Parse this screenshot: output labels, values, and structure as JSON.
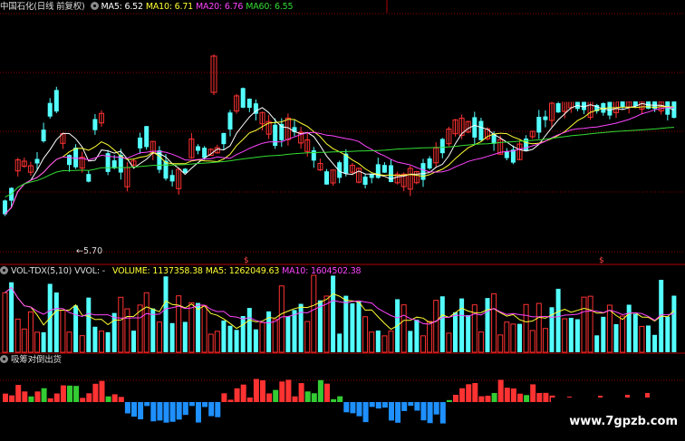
{
  "main": {
    "title": "中国石化(日线 前复权)",
    "ma": [
      {
        "label": "MA5: 6.52",
        "color": "#ffffff"
      },
      {
        "label": "MA10: 6.71",
        "color": "#ffff33"
      },
      {
        "label": "MA20: 6.76",
        "color": "#ff44ff"
      },
      {
        "label": "MA60: 6.55",
        "color": "#33dd33"
      }
    ],
    "low_label": "←5.70",
    "marker": "$"
  },
  "volume": {
    "title": "VOL-TDX(5,10)",
    "vvol": "VVOL: -",
    "volume": "VOLUME: 1137358.38",
    "ma5": "MA5: 1262049.63",
    "ma10": "MA10: 1604502.38",
    "colors": {
      "volume": "#ffff33",
      "ma5": "#ffff33",
      "ma10": "#ff44ff"
    }
  },
  "indicator": {
    "title": "吸筹对倒出货"
  },
  "watermark": "www.7gpzb.com",
  "colors": {
    "up": "#ff3232",
    "down": "#54ffff",
    "neg": "#1e90ff",
    "green": "#33cc33",
    "sep": "#8b0000"
  }
}
